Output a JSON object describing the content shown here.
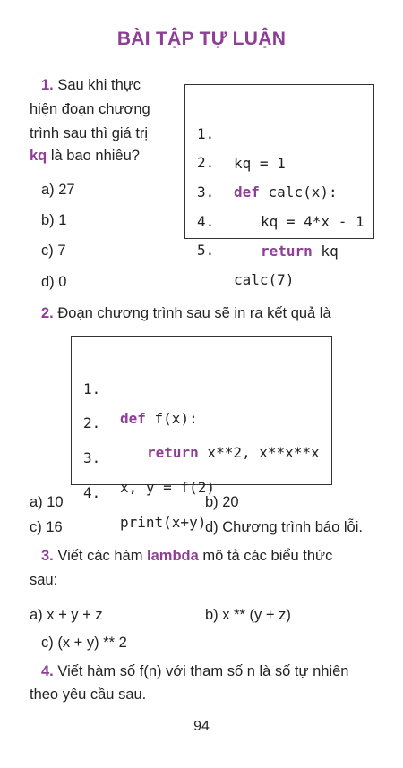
{
  "title": "BÀI TẬP TỰ LUẬN",
  "q1": {
    "number": "1.",
    "text_l1": "Sau khi thực",
    "text_l2": "hiện đoạn chương",
    "text_l3": "trình sau thì giá trị",
    "text_l4_kw": "kq",
    "text_l4_rest": " là bao nhiêu?",
    "options": [
      "a) 27",
      "b) 1",
      "c) 7",
      "d) 0"
    ],
    "code": [
      {
        "ln": "1.",
        "kw": "",
        "text": "kq = 1"
      },
      {
        "ln": "2.",
        "kw": "def",
        "text": " calc(x):"
      },
      {
        "ln": "3.",
        "kw": "",
        "text": "kq = 4*x - 1"
      },
      {
        "ln": "4.",
        "kw": "return",
        "text": " kq"
      },
      {
        "ln": "5.",
        "kw": "",
        "text": "calc(7)"
      }
    ]
  },
  "q2": {
    "number": "2.",
    "text": "Đoạn chương trình sau sẽ in ra kết quả là",
    "code": [
      {
        "ln": "1.",
        "kw": "def",
        "text": " f(x):"
      },
      {
        "ln": "2.",
        "kw": "return",
        "text": " x**2, x**x**x"
      },
      {
        "ln": "3.",
        "kw": "",
        "text": "x, y = f(2)"
      },
      {
        "ln": "4.",
        "kw": "",
        "text": "print(x+y)"
      }
    ],
    "options": [
      "a) 10",
      "b) 20",
      "c) 16",
      "d) Chương trình báo lỗi."
    ]
  },
  "q3": {
    "number": "3.",
    "text_pre": "Viết các hàm",
    "text_kw": "lambda",
    "text_post": "mô tả các biểu thức",
    "text_l2": "sau:",
    "options": [
      "a) x + y + z",
      "b) x ** (y + z)",
      "c) (x + y) ** 2"
    ]
  },
  "q4": {
    "number": "4.",
    "text_l1": "Viết hàm số f(n) với tham số n là số tự nhiên",
    "text_l2": "theo yêu cầu sau."
  },
  "page_number": "94"
}
